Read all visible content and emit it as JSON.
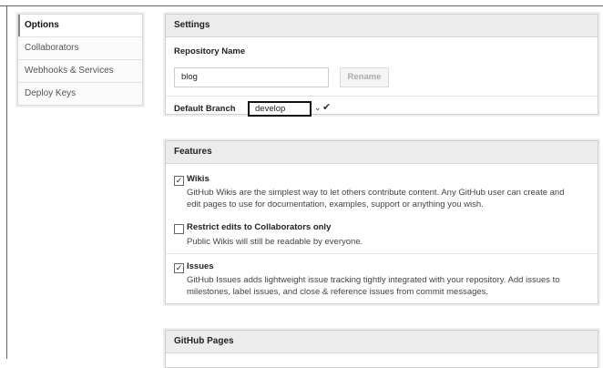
{
  "sidebar": {
    "items": [
      {
        "label": "Options"
      },
      {
        "label": "Collaborators"
      },
      {
        "label": "Webhooks & Services"
      },
      {
        "label": "Deploy Keys"
      }
    ]
  },
  "settings": {
    "title": "Settings",
    "repo_name_label": "Repository Name",
    "repo_name_value": "blog",
    "rename_label": "Rename",
    "default_branch_label": "Default Branch",
    "default_branch_value": "develop"
  },
  "features": {
    "title": "Features",
    "items": [
      {
        "label": "Wikis",
        "checked": true,
        "desc": "GitHub Wikis are the simplest way to let others contribute content. Any GitHub user can create and edit pages to use for documentation, examples, support or anything you wish."
      },
      {
        "label": "Restrict edits to Collaborators only",
        "checked": false,
        "desc": "Public Wikis will still be readable by everyone."
      },
      {
        "label": "Issues",
        "checked": true,
        "desc": "GitHub Issues adds lightweight issue tracking tightly integrated with your repository. Add issues to milestones, label issues, and close & reference issues from commit messages."
      }
    ]
  },
  "pages": {
    "title": "GitHub Pages"
  }
}
